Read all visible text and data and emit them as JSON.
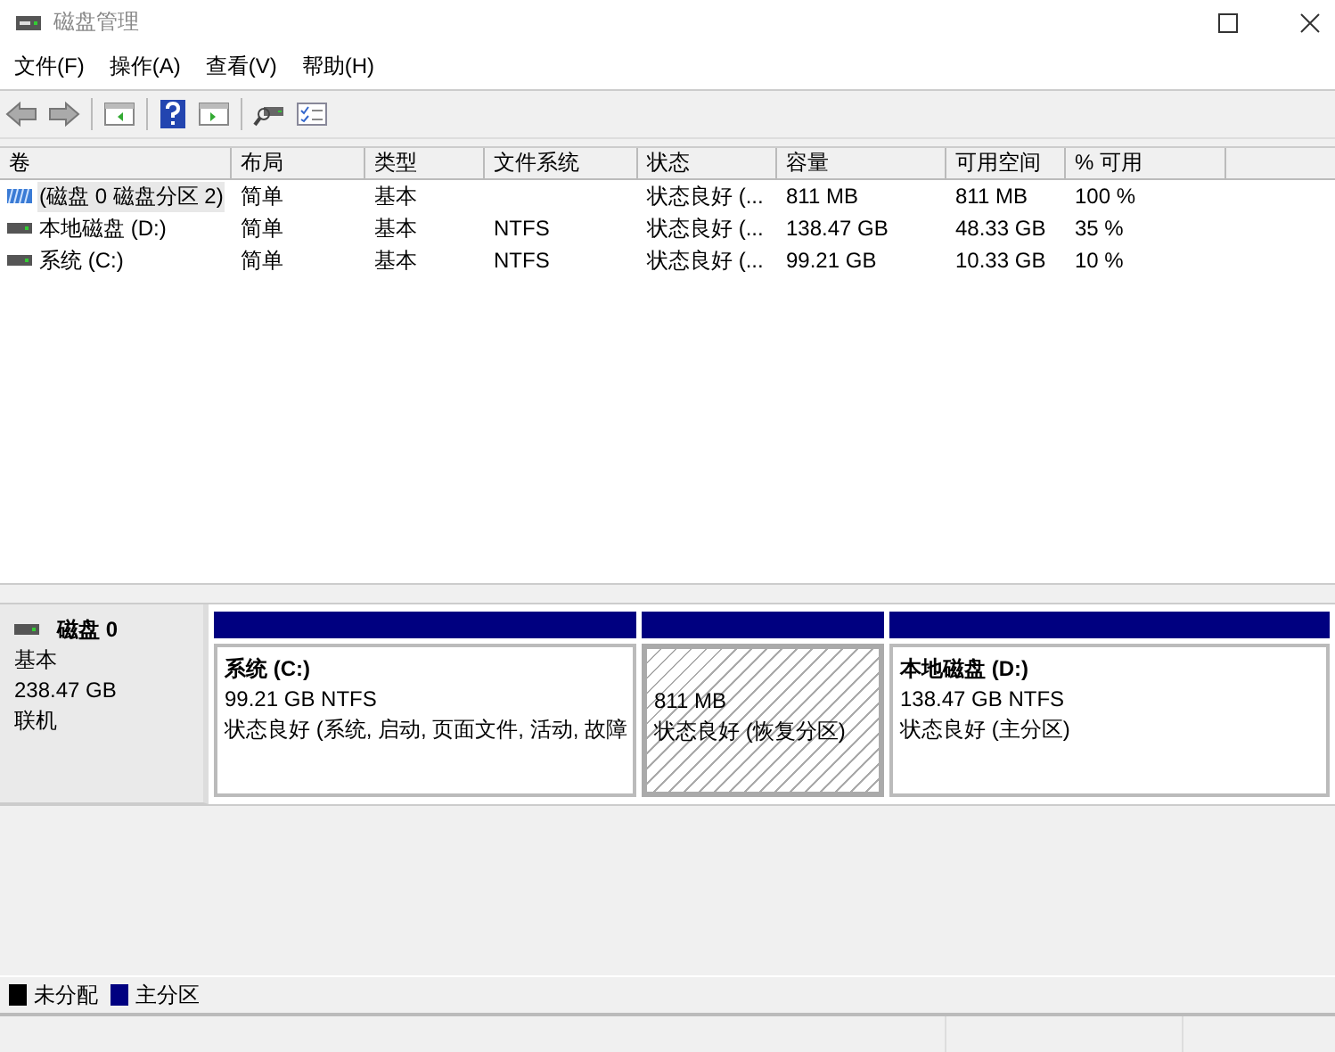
{
  "window": {
    "title": "磁盘管理"
  },
  "menu": [
    "文件(F)",
    "操作(A)",
    "查看(V)",
    "帮助(H)"
  ],
  "table": {
    "columns": [
      "卷",
      "布局",
      "类型",
      "文件系统",
      "状态",
      "容量",
      "可用空间",
      "% 可用"
    ],
    "rows": [
      {
        "kind": "partition",
        "selected": true,
        "cells": [
          "(磁盘 0 磁盘分区 2)",
          "简单",
          "基本",
          "",
          "状态良好 (...",
          "811 MB",
          "811 MB",
          "100 %"
        ]
      },
      {
        "kind": "drive",
        "selected": false,
        "cells": [
          "本地磁盘 (D:)",
          "简单",
          "基本",
          "NTFS",
          "状态良好 (...",
          "138.47 GB",
          "48.33 GB",
          "35 %"
        ]
      },
      {
        "kind": "drive",
        "selected": false,
        "cells": [
          "系统 (C:)",
          "简单",
          "基本",
          "NTFS",
          "状态良好 (...",
          "99.21 GB",
          "10.33 GB",
          "10 %"
        ]
      }
    ]
  },
  "disk": {
    "name": "磁盘 0",
    "type": "基本",
    "size": "238.47 GB",
    "status": "联机",
    "partitions": [
      {
        "kind": "primary",
        "selected": false,
        "name": "系统  (C:)",
        "size": "99.21 GB NTFS",
        "status": "状态良好 (系统, 启动, 页面文件, 活动, 故障"
      },
      {
        "kind": "recovery",
        "selected": true,
        "size": "811 MB",
        "status": "状态良好 (恢复分区)"
      },
      {
        "kind": "primary",
        "selected": false,
        "name": "本地磁盘  (D:)",
        "size": "138.47 GB NTFS",
        "status": "状态良好 (主分区)"
      }
    ]
  },
  "legend": [
    {
      "label": "未分配",
      "color": "#000000"
    },
    {
      "label": "主分区",
      "color": "#000080"
    }
  ]
}
